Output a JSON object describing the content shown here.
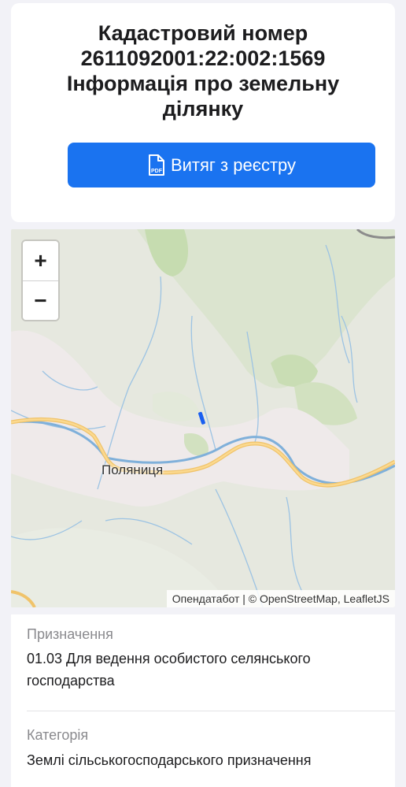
{
  "header": {
    "title_line1": "Кадастровий номер",
    "cadastral_number": "2611092001:22:002:1569",
    "title_line3": "Інформація про земельну",
    "title_line4": "ділянку"
  },
  "extract_button": {
    "label": "Витяг з реєстру",
    "icon": "pdf-file-icon",
    "color": "#1a73f0"
  },
  "map": {
    "zoom_in_label": "+",
    "zoom_out_label": "−",
    "place_label": "Поляниця",
    "parcel_color": "#1a5ff0",
    "attribution": {
      "provider": "Опендатабот",
      "separator": " | © ",
      "osm": "OpenStreetMap",
      "comma": ", ",
      "leaflet": "LeafletJS"
    }
  },
  "details": [
    {
      "label": "Призначення",
      "value": "01.03 Для ведення особистого селянського господарства"
    },
    {
      "label": "Категорія",
      "value": "Землі сільськогосподарського призначення"
    }
  ]
}
